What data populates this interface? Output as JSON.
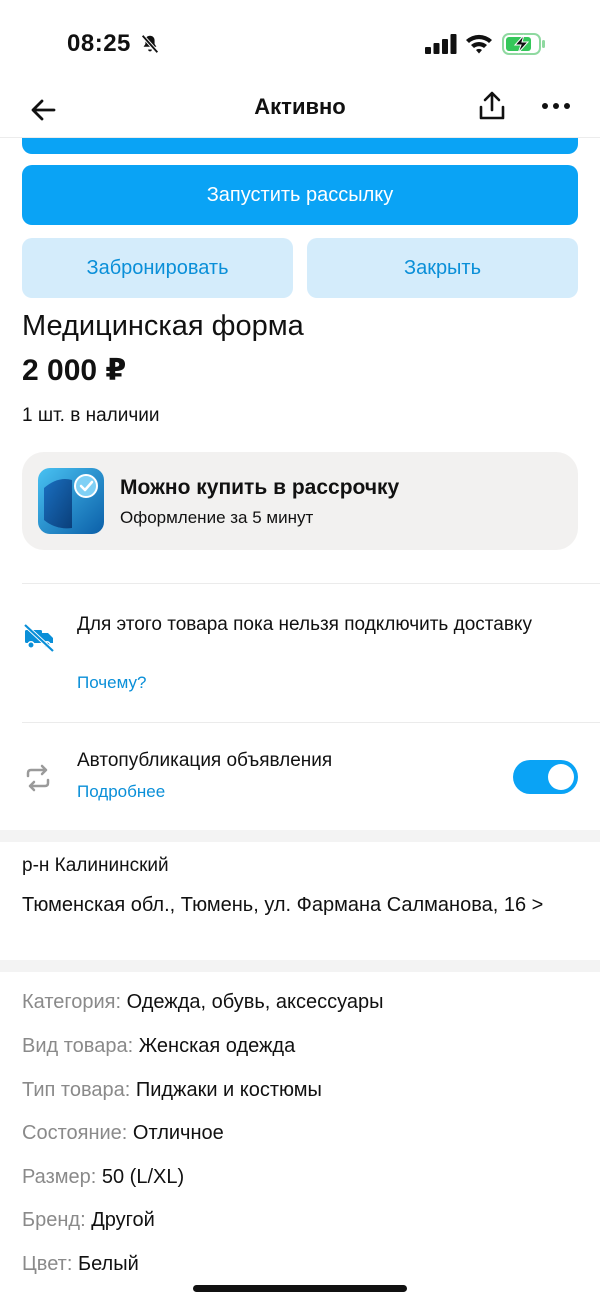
{
  "status_bar": {
    "time": "08:25",
    "icons": [
      "bell-off-icon",
      "cellular-signal-icon",
      "wifi-icon",
      "battery-charging-icon"
    ],
    "battery_color": "#34c759"
  },
  "nav": {
    "title": "Активно",
    "icons": [
      "back-arrow-icon",
      "share-icon",
      "more-icon"
    ]
  },
  "actions": {
    "primary_label": "Запустить рассылку",
    "book_label": "Забронировать",
    "close_label": "Закрыть"
  },
  "item": {
    "title": "Медицинская форма",
    "price": "2 000 ₽",
    "stock": "1 шт. в наличии"
  },
  "installment": {
    "title": "Можно купить в рассрочку",
    "subtitle": "Оформление за 5 минут"
  },
  "delivery": {
    "text": "Для этого товара пока нельзя подключить доставку",
    "link": "Почему?"
  },
  "autopublish": {
    "text": "Автопубликация объявления",
    "link": "Подробнее",
    "enabled": true
  },
  "location": {
    "district": "р-н Калининский",
    "address": "Тюменская обл., Тюмень, ул. Фармана Салманова, 16 >"
  },
  "specs": [
    {
      "label": "Категория:",
      "value": "Одежда, обувь, аксессуары"
    },
    {
      "label": "Вид товара:",
      "value": "Женская одежда"
    },
    {
      "label": "Тип товара:",
      "value": "Пиджаки и костюмы"
    },
    {
      "label": "Состояние:",
      "value": "Отличное"
    },
    {
      "label": "Размер:",
      "value": "50 (L/XL)"
    },
    {
      "label": "Бренд:",
      "value": "Другой"
    },
    {
      "label": "Цвет:",
      "value": "Белый"
    }
  ],
  "colors": {
    "accent": "#0aa3f5",
    "accent_light": "#d4ecfb",
    "link": "#0a8fd8",
    "card_bg": "#f2f1f0"
  }
}
